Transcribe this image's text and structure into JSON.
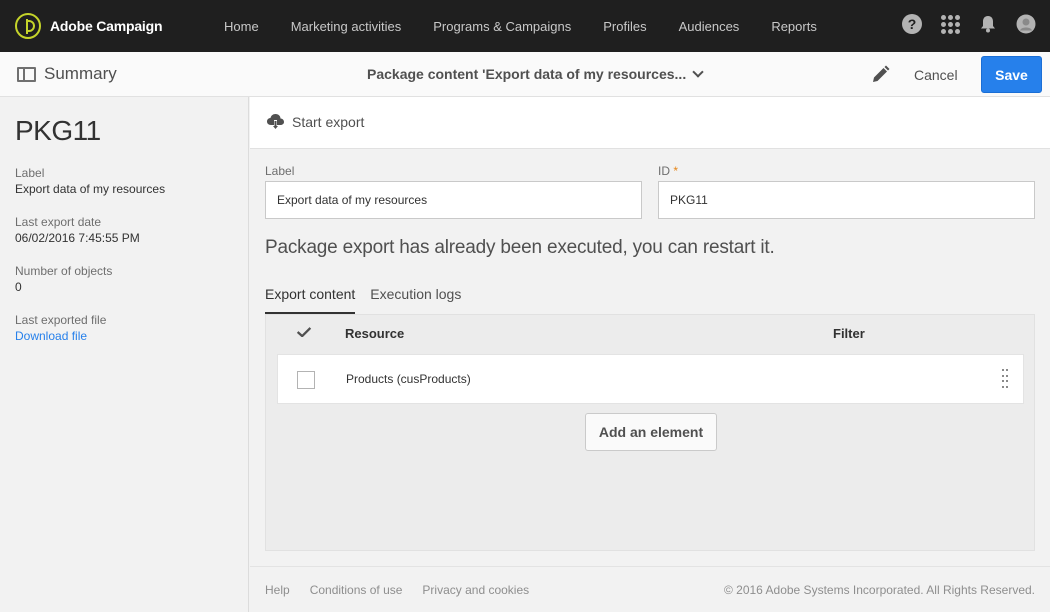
{
  "app": {
    "name": "Adobe Campaign"
  },
  "nav": {
    "items": [
      {
        "label": "Home"
      },
      {
        "label": "Marketing activities"
      },
      {
        "label": "Programs & Campaigns"
      },
      {
        "label": "Profiles"
      },
      {
        "label": "Audiences"
      },
      {
        "label": "Reports"
      }
    ]
  },
  "top_icons": {
    "help": "?",
    "apps": "apps-grid-icon",
    "notifications": "bell-icon",
    "user": "avatar"
  },
  "subheader": {
    "summary_label": "Summary",
    "breadcrumb_title": "Package content 'Export data of my resources...",
    "cancel_label": "Cancel",
    "save_label": "Save"
  },
  "left_panel": {
    "title": "PKG11",
    "label_caption": "Label",
    "label_value": "Export data of my resources",
    "last_export_caption": "Last export date",
    "last_export_value": "06/02/2016 7:45:55 PM",
    "objects_caption": "Number of objects",
    "objects_value": "0",
    "file_caption": "Last exported file",
    "file_link": "Download file"
  },
  "action_bar": {
    "start_export_label": "Start export"
  },
  "form": {
    "label_field": {
      "caption": "Label",
      "value": "Export data of my resources"
    },
    "id_field": {
      "caption": "ID",
      "required_mark": "*",
      "value": "PKG11"
    }
  },
  "notice": "Package export has already been executed, you can restart it.",
  "tabs": [
    {
      "label": "Export content",
      "active": true
    },
    {
      "label": "Execution logs",
      "active": false
    }
  ],
  "table": {
    "headers": {
      "resource": "Resource",
      "filter": "Filter"
    },
    "rows": [
      {
        "resource": "Products (cusProducts)",
        "filter": ""
      }
    ],
    "add_label": "Add an element"
  },
  "footer": {
    "links": [
      "Help",
      "Conditions of use",
      "Privacy and cookies"
    ],
    "copyright": "© 2016 Adobe Systems Incorporated. All Rights Reserved."
  },
  "colors": {
    "accent": "#2680eb",
    "topbar": "#1f1f1f",
    "logo": "#c5d42a",
    "required": "#e68619"
  }
}
